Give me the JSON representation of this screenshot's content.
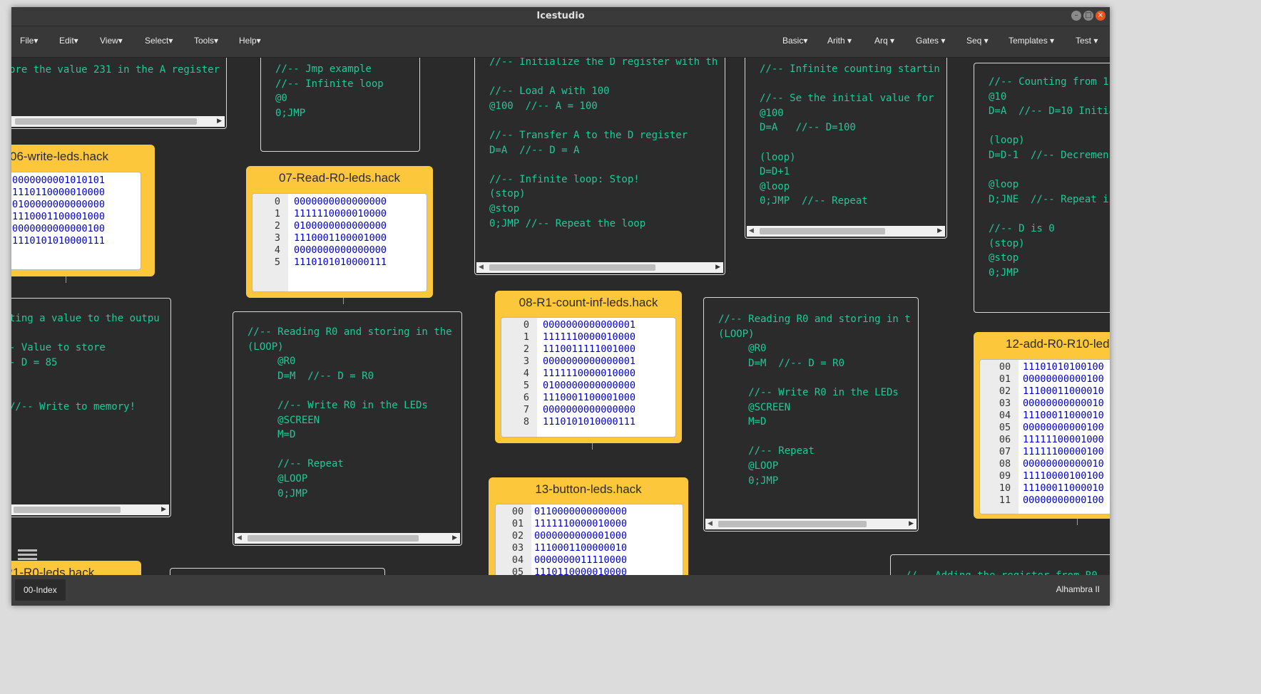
{
  "app": {
    "title": "Icestudio"
  },
  "menu_left": [
    "File▾",
    "Edit▾",
    "View▾",
    "Select▾",
    "Tools▾",
    "Help▾"
  ],
  "menu_right": [
    "Basic▾",
    "Arith ▾",
    "Arq ▾",
    "Gates ▾",
    "Seq ▾",
    "Templates ▾",
    "Test ▾"
  ],
  "code_blocks": {
    "cb1": "ore the value 231 in the A register",
    "cb2": "//-- Jmp example\n//-- Infinite loop\n@0\n0;JMP",
    "cb3": "//-- Initialize the D register with th\n\n//-- Load A with 100\n@100  //-- A = 100\n\n//-- Transfer A to the D register\nD=A  //-- D = A\n\n//-- Infinite loop: Stop!\n(stop)\n@stop\n0;JMP //-- Repeat the loop",
    "cb4": "//-- Infinite counting startin\n\n//-- Se the initial value for\n@100\nD=A   //-- D=100\n\n(loop)\nD=D+1\n@loop\n0;JMP  //-- Repeat",
    "cb5": "//-- Counting from 1\n@10\nD=A  //-- D=10 Initia\n\n(loop)\nD=D-1  //-- Decremen\n\n@loop\nD;JNE  //-- Repeat i\n\n//-- D is 0\n(stop)\n@stop\n0;JMP",
    "cb6": "ting a value to the outpu\n\n- Value to store\n- D = 85\n\n\n//-- Write to memory!",
    "cb7": "//-- Reading R0 and storing in the\n(LOOP)\n     @R0\n     D=M  //-- D = R0\n\n     //-- Write R0 in the LEDs\n     @SCREEN\n     M=D\n\n     //-- Repeat\n     @LOOP\n     0;JMP",
    "cb8": "//-- Reading R0 and storing in t\n(LOOP)\n     @R0\n     D=M  //-- D = R0\n\n     //-- Write R0 in the LEDs\n     @SCREEN\n     M=D\n\n     //-- Repeat\n     @LOOP\n     0;JMP",
    "cb9": "",
    "cb10": "//-- Adding the register from R0"
  },
  "hack_blocks": {
    "h06": {
      "title": "06-write-leds.hack",
      "rows": [
        {
          "n": "",
          "v": "0000000001010101"
        },
        {
          "n": "",
          "v": "1110110000010000"
        },
        {
          "n": "",
          "v": "0100000000000000"
        },
        {
          "n": "",
          "v": "1110001100001000"
        },
        {
          "n": "",
          "v": "0000000000000100"
        },
        {
          "n": "",
          "v": "1110101010000111"
        }
      ]
    },
    "h07": {
      "title": "07-Read-R0-leds.hack",
      "rows": [
        {
          "n": "0",
          "v": "0000000000000000"
        },
        {
          "n": "1",
          "v": "1111110000010000"
        },
        {
          "n": "2",
          "v": "0100000000000000"
        },
        {
          "n": "3",
          "v": "1110001100001000"
        },
        {
          "n": "4",
          "v": "0000000000000000"
        },
        {
          "n": "5",
          "v": "1110101010000111"
        }
      ]
    },
    "h08": {
      "title": "08-R1-count-inf-leds.hack",
      "rows": [
        {
          "n": "0",
          "v": "0000000000000001"
        },
        {
          "n": "1",
          "v": "1111110000010000"
        },
        {
          "n": "2",
          "v": "1110011111001000"
        },
        {
          "n": "3",
          "v": "0000000000000001"
        },
        {
          "n": "4",
          "v": "1111110000010000"
        },
        {
          "n": "5",
          "v": "0100000000000000"
        },
        {
          "n": "6",
          "v": "1110001100001000"
        },
        {
          "n": "7",
          "v": "0000000000000000"
        },
        {
          "n": "8",
          "v": "1110101010000111"
        }
      ]
    },
    "h13": {
      "title": "13-button-leds.hack",
      "rows": [
        {
          "n": "00",
          "v": "0110000000000000"
        },
        {
          "n": "01",
          "v": "1111110000010000"
        },
        {
          "n": "02",
          "v": "0000000000001000"
        },
        {
          "n": "03",
          "v": "1110001100000010"
        },
        {
          "n": "04",
          "v": "0000000011110000"
        },
        {
          "n": "05",
          "v": "1110110000010000"
        }
      ]
    },
    "h12": {
      "title": "12-add-R0-R10-led",
      "rows": [
        {
          "n": "00",
          "v": "11101010100100"
        },
        {
          "n": "01",
          "v": "00000000000100"
        },
        {
          "n": "02",
          "v": "11100011000010"
        },
        {
          "n": "03",
          "v": "00000000000010"
        },
        {
          "n": "04",
          "v": "11100011000010"
        },
        {
          "n": "05",
          "v": "00000000000100"
        },
        {
          "n": "06",
          "v": "11111100001000"
        },
        {
          "n": "07",
          "v": "11111100000100"
        },
        {
          "n": "08",
          "v": "00000000000010"
        },
        {
          "n": "09",
          "v": "11110000100100"
        },
        {
          "n": "10",
          "v": "11100011000010"
        },
        {
          "n": "11",
          "v": "00000000000100"
        }
      ]
    },
    "h_partial": {
      "title": "-R1-R0-leds.hack",
      "rows": []
    }
  },
  "status": {
    "tab": "00-Index",
    "board": "Alhambra II"
  },
  "colors": {
    "code_text": "#20c997",
    "hack_block": "#fcc73a",
    "memory_value": "#0000cd",
    "close_button": "#e95420"
  },
  "icons": [
    "minimize-icon",
    "maximize-icon",
    "close-icon",
    "hamburger-menu-icon"
  ]
}
